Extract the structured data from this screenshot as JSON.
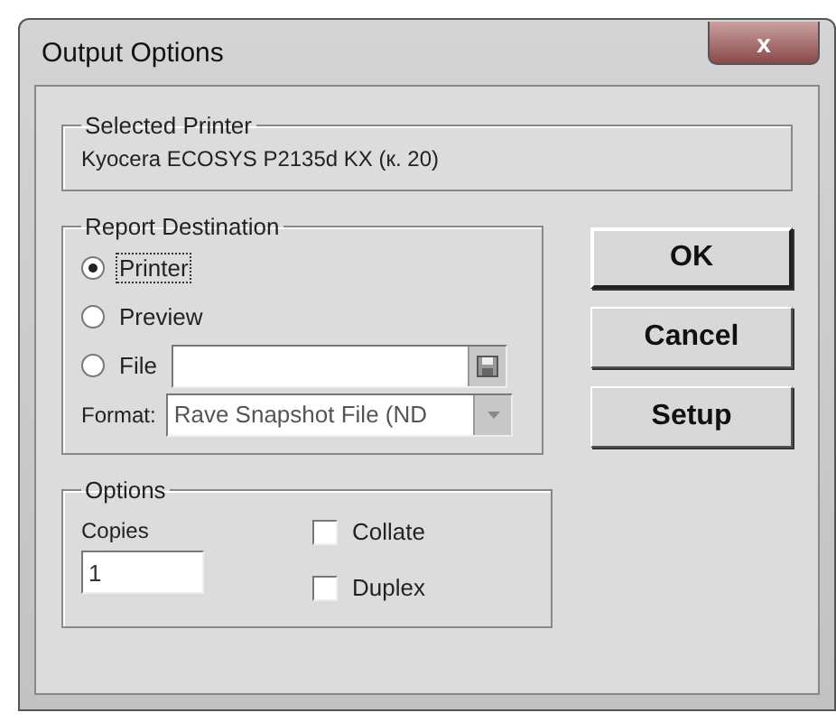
{
  "window": {
    "title": "Output Options",
    "close": "x"
  },
  "selected_printer": {
    "legend": "Selected Printer",
    "name": "Kyocera ECOSYS P2135d KX (к. 20)"
  },
  "report_destination": {
    "legend": "Report Destination",
    "options": [
      {
        "label": "Printer",
        "selected": true,
        "kind": "plain"
      },
      {
        "label": "Preview",
        "selected": false,
        "kind": "plain"
      },
      {
        "label": "File",
        "selected": false,
        "kind": "file"
      }
    ],
    "format_label": "Format:",
    "format_value": "Rave Snapshot File (ND"
  },
  "buttons": [
    {
      "label": "OK",
      "default": true
    },
    {
      "label": "Cancel",
      "default": false
    },
    {
      "label": "Setup",
      "default": false
    }
  ],
  "options": {
    "legend": "Options",
    "copies_label": "Copies",
    "copies_value": "1",
    "checkboxes": [
      {
        "label": "Collate",
        "checked": false
      },
      {
        "label": "Duplex",
        "checked": false
      }
    ]
  }
}
